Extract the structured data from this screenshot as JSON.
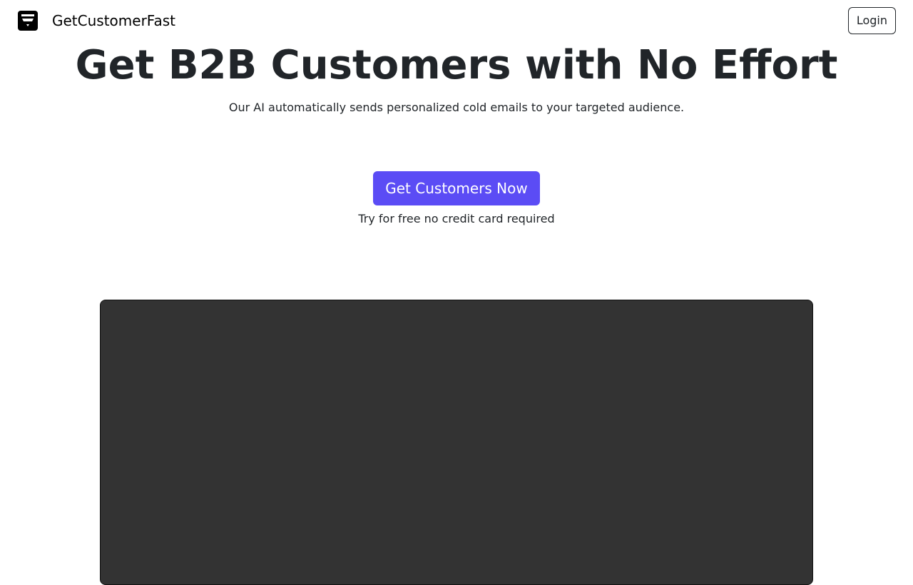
{
  "navbar": {
    "brand_name": "GetCustomerFast",
    "logo_icon": "funnel-logo-icon",
    "login_label": "Login"
  },
  "hero": {
    "title": "Get B2B Customers with No Effort",
    "subtitle": "Our AI automatically sends personalized cold emails to your targeted audience.",
    "cta_label": "Get Customers Now",
    "cta_note": "Try for free no credit card required"
  },
  "colors": {
    "accent": "#5b4cf5",
    "text": "#212529",
    "video_background": "#333333"
  }
}
